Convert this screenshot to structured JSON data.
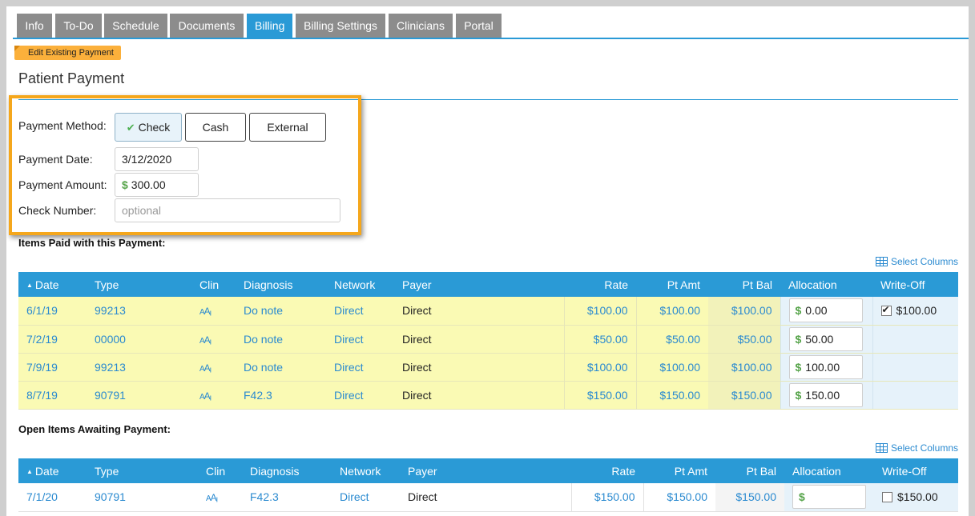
{
  "tabs": [
    {
      "label": "Info",
      "active": false
    },
    {
      "label": "To-Do",
      "active": false
    },
    {
      "label": "Schedule",
      "active": false
    },
    {
      "label": "Documents",
      "active": false
    },
    {
      "label": "Billing",
      "active": true
    },
    {
      "label": "Billing Settings",
      "active": false
    },
    {
      "label": "Clinicians",
      "active": false
    },
    {
      "label": "Portal",
      "active": false
    }
  ],
  "badge": "Edit Existing Payment",
  "page_title": "Patient Payment",
  "form": {
    "payment_method_label": "Payment Method:",
    "methods": [
      {
        "label": "Check",
        "selected": true
      },
      {
        "label": "Cash",
        "selected": false
      },
      {
        "label": "External",
        "selected": false
      }
    ],
    "payment_date_label": "Payment Date:",
    "payment_date": "3/12/2020",
    "payment_amount_label": "Payment Amount:",
    "payment_amount": "300.00",
    "check_number_label": "Check Number:",
    "check_number_placeholder": "optional",
    "currency_symbol": "$"
  },
  "paid_section": {
    "heading": "Items Paid with this Payment:",
    "select_columns": "Select Columns",
    "columns": [
      "Date",
      "Type",
      "Clin",
      "Diagnosis",
      "Network",
      "Payer",
      "Rate",
      "Pt Amt",
      "Pt Bal",
      "Allocation",
      "Write-Off"
    ],
    "clin_icon": "AA",
    "rows": [
      {
        "date": "6/1/19",
        "type": "99213",
        "diagnosis": "Do note",
        "network": "Direct",
        "payer": "Direct",
        "rate": "$100.00",
        "pt_amt": "$100.00",
        "pt_bal": "$100.00",
        "allocation": "0.00",
        "writeoff_checked": true,
        "writeoff": "$100.00"
      },
      {
        "date": "7/2/19",
        "type": "00000",
        "diagnosis": "Do note",
        "network": "Direct",
        "payer": "Direct",
        "rate": "$50.00",
        "pt_amt": "$50.00",
        "pt_bal": "$50.00",
        "allocation": "50.00",
        "writeoff_checked": false,
        "writeoff": ""
      },
      {
        "date": "7/9/19",
        "type": "99213",
        "diagnosis": "Do note",
        "network": "Direct",
        "payer": "Direct",
        "rate": "$100.00",
        "pt_amt": "$100.00",
        "pt_bal": "$100.00",
        "allocation": "100.00",
        "writeoff_checked": false,
        "writeoff": ""
      },
      {
        "date": "8/7/19",
        "type": "90791",
        "diagnosis": "F42.3",
        "network": "Direct",
        "payer": "Direct",
        "rate": "$150.00",
        "pt_amt": "$150.00",
        "pt_bal": "$150.00",
        "allocation": "150.00",
        "writeoff_checked": false,
        "writeoff": ""
      }
    ]
  },
  "open_section": {
    "heading": "Open Items Awaiting Payment:",
    "select_columns": "Select Columns",
    "columns": [
      "Date",
      "Type",
      "Clin",
      "Diagnosis",
      "Network",
      "Payer",
      "Rate",
      "Pt Amt",
      "Pt Bal",
      "Allocation",
      "Write-Off"
    ],
    "clin_icon": "AA",
    "rows": [
      {
        "date": "7/1/20",
        "type": "90791",
        "diagnosis": "F42.3",
        "network": "Direct",
        "payer": "Direct",
        "rate": "$150.00",
        "pt_amt": "$150.00",
        "pt_bal": "$150.00",
        "allocation": "",
        "writeoff_checked": false,
        "writeoff": "$150.00"
      }
    ]
  }
}
